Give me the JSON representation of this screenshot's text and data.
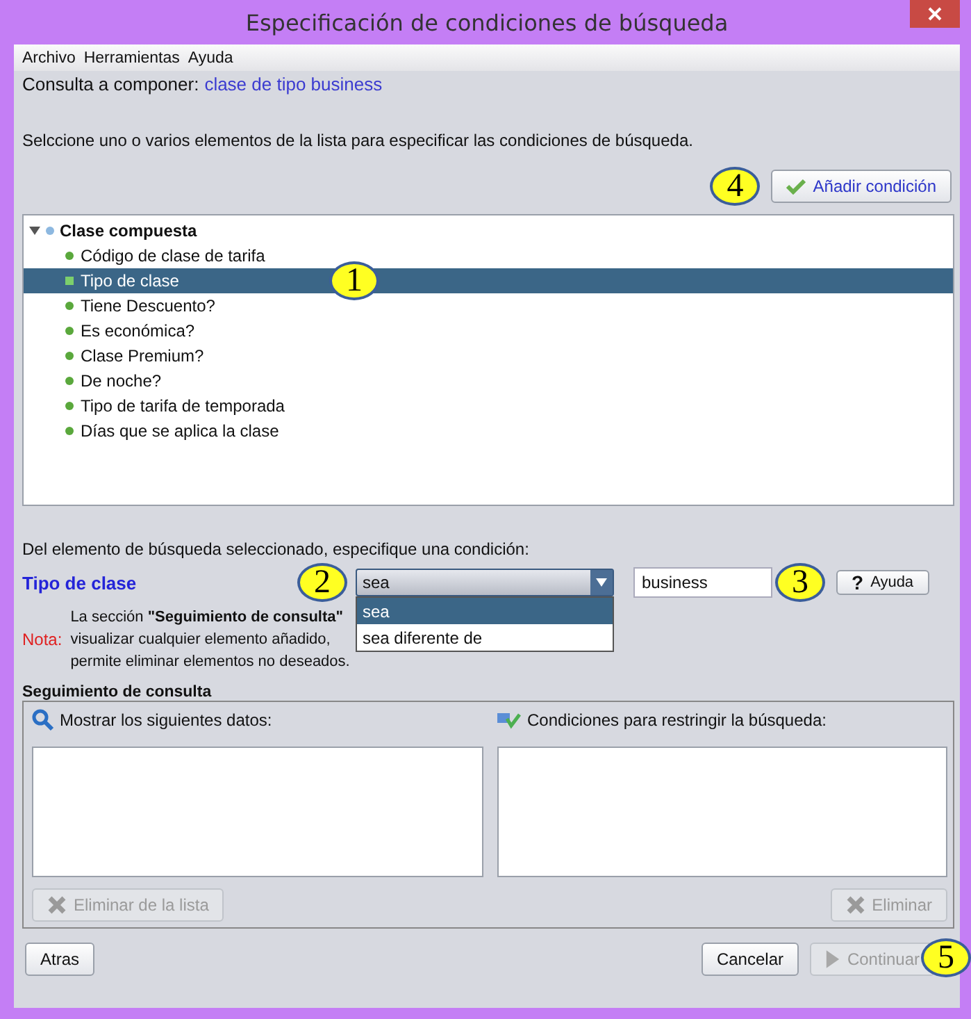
{
  "window": {
    "title": "Especificación de condiciones de búsqueda"
  },
  "menu": [
    "Archivo",
    "Herramientas",
    "Ayuda"
  ],
  "query": {
    "label": "Consulta a componer:",
    "value": "clase de tipo business"
  },
  "instruction": "Selccione uno o varios elementos de la lista para especificar las condiciones de búsqueda.",
  "add_button": {
    "label": "Añadir condición",
    "callout": "4"
  },
  "tree": {
    "root": {
      "label": "Clase compuesta",
      "expanded": true,
      "children": [
        {
          "label": "Código de clase de tarifa",
          "selected": false
        },
        {
          "label": "Tipo de clase",
          "selected": true,
          "callout": "1"
        },
        {
          "label": "Tiene Descuento?",
          "selected": false
        },
        {
          "label": "Es económica?",
          "selected": false
        },
        {
          "label": "Clase Premium?",
          "selected": false
        },
        {
          "label": "De noche?",
          "selected": false
        },
        {
          "label": "Tipo de tarifa de temporada",
          "selected": false
        },
        {
          "label": "Días que se aplica la clase",
          "selected": false
        }
      ]
    }
  },
  "condition": {
    "prompt": "Del elemento de búsqueda seleccionado, especifique una condición:",
    "element": "Tipo de clase",
    "operator": "sea",
    "operator_callout": "2",
    "value": "business",
    "value_callout": "3",
    "help_button": "Ayuda",
    "help_glyph": "?",
    "dropdown": [
      {
        "label": "sea",
        "selected": true
      },
      {
        "label": "sea diferente de",
        "selected": false
      }
    ]
  },
  "note": {
    "label": "Nota:",
    "lines": [
      "La sección **\"Seguimiento de consulta\"**",
      "visualizar cualquier elemento añadido,",
      "permite eliminar elementos no deseados."
    ]
  },
  "tracking": {
    "title": "Seguimiento de consulta",
    "left": {
      "label": "Mostrar los siguientes datos:",
      "button": "Eliminar de la lista",
      "button_disabled": true
    },
    "right": {
      "label": "Condiciones para restringir la búsqueda:",
      "button": "Eliminar",
      "button_disabled": true
    }
  },
  "footer": {
    "back": "Atras",
    "cancel": "Cancelar",
    "continue": "Continuar",
    "continue_disabled": true,
    "continue_callout": "5"
  }
}
